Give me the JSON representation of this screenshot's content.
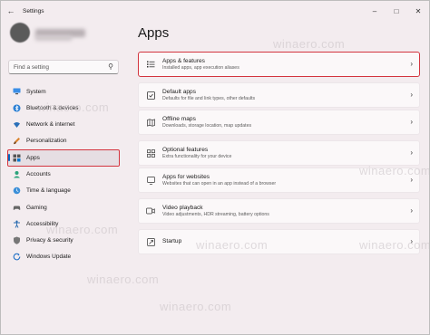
{
  "window": {
    "title": "Settings"
  },
  "sidebar": {
    "search_placeholder": "Find a setting",
    "items": [
      {
        "label": "System",
        "icon": "monitor-icon"
      },
      {
        "label": "Bluetooth & devices",
        "icon": "bluetooth-icon"
      },
      {
        "label": "Network & internet",
        "icon": "wifi-icon"
      },
      {
        "label": "Personalization",
        "icon": "brush-icon"
      },
      {
        "label": "Apps",
        "icon": "apps-icon",
        "active": true
      },
      {
        "label": "Accounts",
        "icon": "person-icon"
      },
      {
        "label": "Time & language",
        "icon": "globe-clock-icon"
      },
      {
        "label": "Gaming",
        "icon": "gamepad-icon"
      },
      {
        "label": "Accessibility",
        "icon": "accessibility-icon"
      },
      {
        "label": "Privacy & security",
        "icon": "shield-icon"
      },
      {
        "label": "Windows Update",
        "icon": "update-icon"
      }
    ]
  },
  "main": {
    "title": "Apps",
    "cards": [
      {
        "title": "Apps & features",
        "subtitle": "Installed apps, app execution aliases",
        "icon": "list-icon"
      },
      {
        "title": "Default apps",
        "subtitle": "Defaults for file and link types, other defaults",
        "icon": "default-apps-icon"
      },
      {
        "title": "Offline maps",
        "subtitle": "Downloads, storage location, map updates",
        "icon": "map-icon"
      },
      {
        "title": "Optional features",
        "subtitle": "Extra functionality for your device",
        "icon": "grid-icon"
      },
      {
        "title": "Apps for websites",
        "subtitle": "Websites that can open in an app instead of a browser",
        "icon": "link-icon"
      },
      {
        "title": "Video playback",
        "subtitle": "Video adjustments, HDR streaming, battery options",
        "icon": "video-icon"
      },
      {
        "title": "Startup",
        "subtitle": "",
        "icon": "startup-icon"
      }
    ]
  },
  "watermark": "winaero.com",
  "colors": {
    "accent": "#0067c0",
    "highlight": "#d3343e"
  }
}
